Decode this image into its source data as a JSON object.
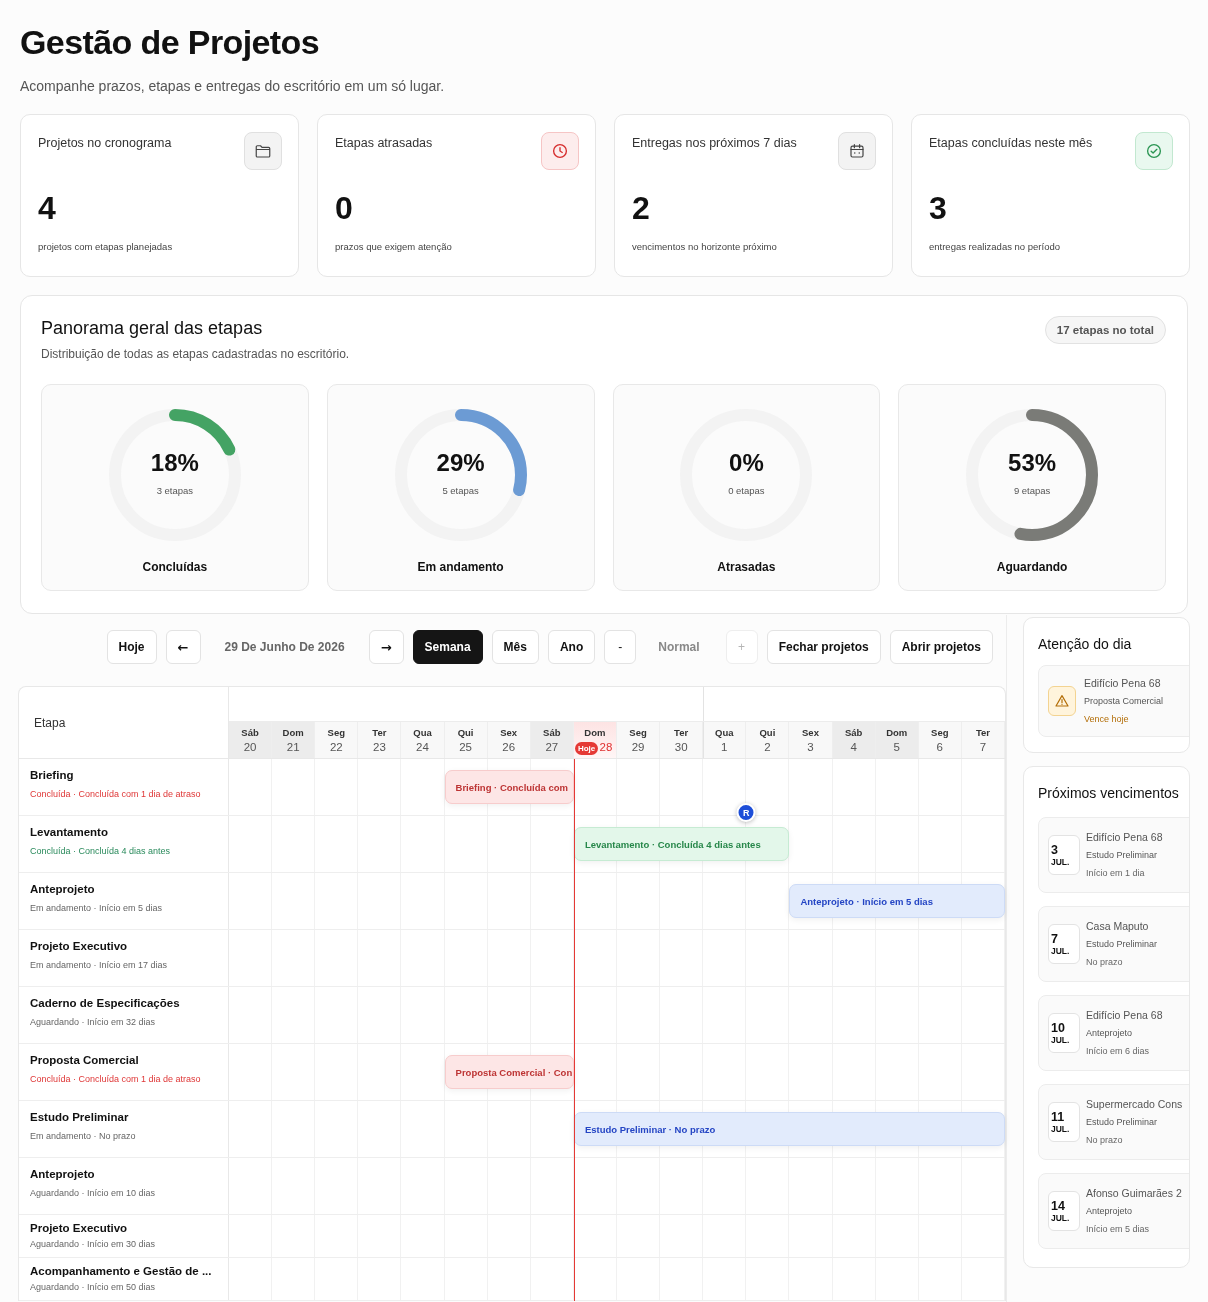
{
  "header": {
    "title": "Gestão de Projetos",
    "subtitle": "Acompanhe prazos, etapas e entregas do escritório em um só lugar."
  },
  "stats": [
    {
      "kind": "projects",
      "label": "Projetos no cronograma",
      "value": "4",
      "caption": "projetos com etapas planejadas"
    },
    {
      "kind": "overdue",
      "label": "Etapas atrasadas",
      "value": "0",
      "caption": "prazos que exigem atenção"
    },
    {
      "kind": "upcoming",
      "label": "Entregas nos próximos 7 dias",
      "value": "2",
      "caption": "vencimentos no horizonte próximo"
    },
    {
      "kind": "completed",
      "label": "Etapas concluídas neste mês",
      "value": "3",
      "caption": "entregas realizadas no período"
    }
  ],
  "overview": {
    "title": "Panorama geral das etapas",
    "subtitle": "Distribuição de todas as etapas cadastradas no escritório.",
    "total": "17 etapas no total",
    "rings": [
      {
        "percent": "18%",
        "count": "3 etapas",
        "label": "Concluídas",
        "level": 0.18,
        "color": "#44a364"
      },
      {
        "percent": "29%",
        "count": "5 etapas",
        "label": "Em andamento",
        "level": 0.29,
        "color": "#6c9bd4"
      },
      {
        "percent": "0%",
        "count": "0 etapas",
        "label": "Atrasadas"
      },
      {
        "percent": "53%",
        "count": "9 etapas",
        "label": "Aguardando",
        "level": 0.53,
        "color": "#7a7b77"
      }
    ]
  },
  "toolbar": {
    "today": "Hoje",
    "prev": "←",
    "date": "29 De Junho De 2026",
    "next": "→",
    "views": [
      {
        "label": "Semana",
        "selected": true
      },
      {
        "label": "Mês",
        "selected": false
      },
      {
        "label": "Ano",
        "selected": false
      }
    ],
    "zoom_out": {
      "label": "-",
      "disabled": false
    },
    "zoom": "Normal",
    "zoom_in": {
      "label": "+",
      "disabled": true
    },
    "actions": [
      "Fechar projetos",
      "Abrir projetos"
    ]
  },
  "gantt": {
    "column_header": "Etapa",
    "today_label": "Hoje",
    "days": [
      {
        "weekday": "Sáb",
        "day": "20",
        "weekend": true,
        "today": false,
        "month_start": false
      },
      {
        "weekday": "Dom",
        "day": "21",
        "weekend": true,
        "today": false,
        "month_start": false
      },
      {
        "weekday": "Seg",
        "day": "22",
        "weekend": false,
        "today": false,
        "month_start": false
      },
      {
        "weekday": "Ter",
        "day": "23",
        "weekend": false,
        "today": false,
        "month_start": false
      },
      {
        "weekday": "Qua",
        "day": "24",
        "weekend": false,
        "today": false,
        "month_start": false
      },
      {
        "weekday": "Qui",
        "day": "25",
        "weekend": false,
        "today": false,
        "month_start": false
      },
      {
        "weekday": "Sex",
        "day": "26",
        "weekend": false,
        "today": false,
        "month_start": false
      },
      {
        "weekday": "Sáb",
        "day": "27",
        "weekend": true,
        "today": false,
        "month_start": false
      },
      {
        "weekday": "Dom",
        "day": "28",
        "weekend": true,
        "today": true,
        "month_start": false
      },
      {
        "weekday": "Seg",
        "day": "29",
        "weekend": false,
        "today": false,
        "month_start": false
      },
      {
        "weekday": "Ter",
        "day": "30",
        "weekend": false,
        "today": false,
        "month_start": false
      },
      {
        "weekday": "Qua",
        "day": "1",
        "weekend": false,
        "today": false,
        "month_start": true
      },
      {
        "weekday": "Qui",
        "day": "2",
        "weekend": false,
        "today": false,
        "month_start": false
      },
      {
        "weekday": "Sex",
        "day": "3",
        "weekend": false,
        "today": false,
        "month_start": false
      },
      {
        "weekday": "Sáb",
        "day": "4",
        "weekend": true,
        "today": false,
        "month_start": false
      },
      {
        "weekday": "Dom",
        "day": "5",
        "weekend": true,
        "today": false,
        "month_start": false
      },
      {
        "weekday": "Seg",
        "day": "6",
        "weekend": false,
        "today": false,
        "month_start": false
      },
      {
        "weekday": "Ter",
        "day": "7",
        "weekend": false,
        "today": false,
        "month_start": false
      }
    ],
    "rows": [
      {
        "title": "Briefing",
        "status_text": "Concluída · Concluída com 1 dia de atraso",
        "kind": "late",
        "bar_label": "Briefing · Concluída com",
        "cells": [
          {
            "covered": false
          },
          {
            "covered": false
          },
          {
            "covered": false
          },
          {
            "covered": false
          },
          {
            "covered": false
          },
          {
            "covered": true
          },
          {
            "covered": true
          },
          {
            "covered": true
          },
          {
            "covered": false
          },
          {
            "covered": false
          },
          {
            "covered": false
          },
          {
            "covered": false
          },
          {
            "covered": false
          },
          {
            "covered": false
          },
          {
            "covered": false
          },
          {
            "covered": false
          },
          {
            "covered": false
          },
          {
            "covered": false
          }
        ]
      },
      {
        "title": "Levantamento",
        "status_text": "Concluída · Concluída 4 dias antes",
        "kind": "early",
        "bar_label": "Levantamento · Concluída 4 dias antes",
        "cells": [
          {
            "covered": false
          },
          {
            "covered": false
          },
          {
            "covered": false
          },
          {
            "covered": false
          },
          {
            "covered": false
          },
          {
            "covered": false
          },
          {
            "covered": false
          },
          {
            "covered": false
          },
          {
            "covered": true
          },
          {
            "covered": true
          },
          {
            "covered": true
          },
          {
            "covered": true
          },
          {
            "covered": true,
            "marker": "R"
          },
          {
            "covered": false
          },
          {
            "covered": false
          },
          {
            "covered": false
          },
          {
            "covered": false
          },
          {
            "covered": false
          }
        ]
      },
      {
        "title": "Anteprojeto",
        "status_text": "Em andamento · Início em 5 dias",
        "kind": "active",
        "bar_label": "Anteprojeto · Início em 5 dias",
        "cells": [
          {
            "covered": false
          },
          {
            "covered": false
          },
          {
            "covered": false
          },
          {
            "covered": false
          },
          {
            "covered": false
          },
          {
            "covered": false
          },
          {
            "covered": false
          },
          {
            "covered": false
          },
          {
            "covered": false
          },
          {
            "covered": false
          },
          {
            "covered": false
          },
          {
            "covered": false
          },
          {
            "covered": false
          },
          {
            "covered": true
          },
          {
            "covered": true
          },
          {
            "covered": true
          },
          {
            "covered": true
          },
          {
            "covered": true
          }
        ]
      },
      {
        "title": "Projeto Executivo",
        "status_text": "Em andamento · Início em 17 dias",
        "kind": "active"
      },
      {
        "title": "Caderno de Especificações",
        "status_text": "Aguardando · Início em 32 dias",
        "kind": "waiting"
      },
      {
        "title": "Proposta Comercial",
        "status_text": "Concluída · Concluída com 1 dia de atraso",
        "kind": "late",
        "bar_label": "Proposta Comercial · Con",
        "cells": [
          {
            "covered": false
          },
          {
            "covered": false
          },
          {
            "covered": false
          },
          {
            "covered": false
          },
          {
            "covered": false
          },
          {
            "covered": true
          },
          {
            "covered": true
          },
          {
            "covered": true
          },
          {
            "covered": false
          },
          {
            "covered": false
          },
          {
            "covered": false
          },
          {
            "covered": false
          },
          {
            "covered": false
          },
          {
            "covered": false
          },
          {
            "covered": false
          },
          {
            "covered": false
          },
          {
            "covered": false
          },
          {
            "covered": false
          }
        ]
      },
      {
        "title": "Estudo Preliminar",
        "status_text": "Em andamento · No prazo",
        "kind": "active",
        "bar_label": "Estudo Preliminar · No prazo",
        "cells": [
          {
            "covered": false
          },
          {
            "covered": false
          },
          {
            "covered": false
          },
          {
            "covered": false
          },
          {
            "covered": false
          },
          {
            "covered": false
          },
          {
            "covered": false
          },
          {
            "covered": false
          },
          {
            "covered": true
          },
          {
            "covered": true
          },
          {
            "covered": true
          },
          {
            "covered": true
          },
          {
            "covered": true
          },
          {
            "covered": true
          },
          {
            "covered": true
          },
          {
            "covered": true
          },
          {
            "covered": true
          },
          {
            "covered": true
          }
        ]
      },
      {
        "title": "Anteprojeto",
        "status_text": "Aguardando · Início em 10 dias",
        "kind": "waiting"
      },
      {
        "title": "Projeto Executivo",
        "status_text": "Aguardando · Início em 30 dias",
        "kind": "waiting"
      },
      {
        "title": "Acompanhamento e Gestão de ...",
        "status_text": "Aguardando · Início em 50 dias",
        "kind": "waiting"
      }
    ]
  },
  "attention": {
    "title": "Atenção do dia",
    "items": [
      {
        "project": "Edifício Pena 68",
        "stage": "Proposta Comercial",
        "status": "Vence hoje"
      }
    ]
  },
  "upcoming": {
    "title": "Próximos vencimentos",
    "items": [
      {
        "day": "3",
        "month": "JUL.",
        "project": "Edifício Pena 68",
        "stage": "Estudo Preliminar",
        "status": "Início em 1 dia"
      },
      {
        "day": "7",
        "month": "JUL.",
        "project": "Casa Maputo",
        "stage": "Estudo Preliminar",
        "status": "No prazo"
      },
      {
        "day": "10",
        "month": "JUL.",
        "project": "Edifício Pena 68",
        "stage": "Anteprojeto",
        "status": "Início em 6 dias"
      },
      {
        "day": "11",
        "month": "JUL.",
        "project": "Supermercado Cons",
        "stage": "Estudo Preliminar",
        "status": "No prazo"
      },
      {
        "day": "14",
        "month": "JUL.",
        "project": "Afonso Guimarães 2",
        "stage": "Anteprojeto",
        "status": "Início em 5 dias"
      }
    ]
  }
}
